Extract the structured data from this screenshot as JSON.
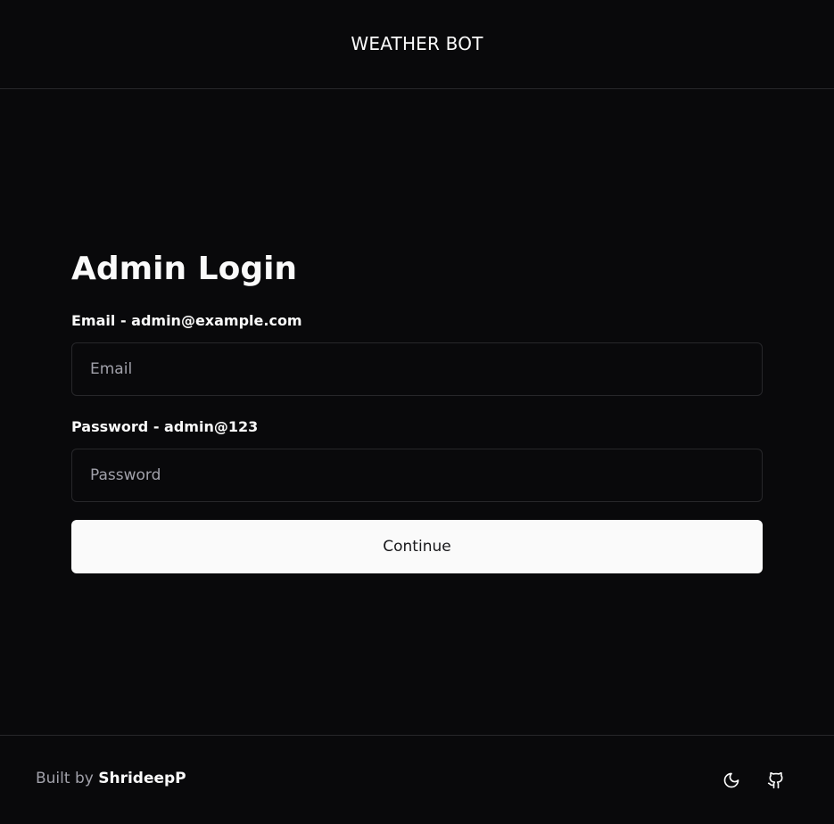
{
  "header": {
    "title": "WEATHER BOT"
  },
  "login": {
    "title": "Admin Login",
    "email_label": "Email - admin@example.com",
    "email_placeholder": "Email",
    "email_value": "",
    "password_label": "Password - admin@123",
    "password_placeholder": "Password",
    "password_value": "",
    "submit_label": "Continue"
  },
  "footer": {
    "built_by_prefix": "Built by",
    "author": "ShrideepP",
    "icons": [
      "moon-icon",
      "github-icon"
    ]
  },
  "colors": {
    "background": "#09090b",
    "border": "#27272a",
    "text": "#fafafa",
    "muted_text": "#a1a1aa",
    "button_background": "#fafafa",
    "button_text": "#18181b"
  }
}
